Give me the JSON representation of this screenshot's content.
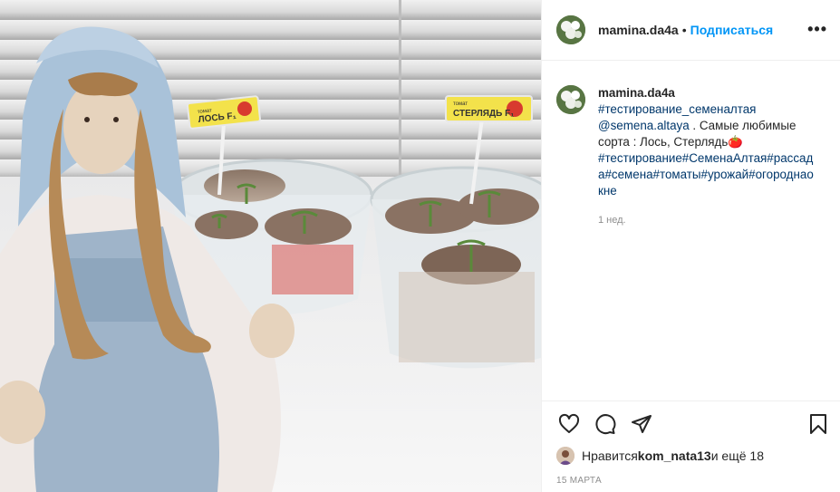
{
  "post": {
    "username": "mamina.da4a",
    "follow_label": "Подписаться",
    "more_label": "•••",
    "dot": "•"
  },
  "caption": {
    "username": "mamina.da4a",
    "tag1": "#тестирование_семеналтая",
    "mention": "@semena.altaya",
    "text1": " . Самые любимые сорта : Лось, Стерлядь",
    "symbol": "🍅",
    "tags2": "#тестирование#СеменаАлтая#рассада#семена#томаты#урожай#огороднаокне",
    "time": "1 нед."
  },
  "photo": {
    "label_left_small": "томат",
    "label_left": "ЛОСЬ F₁",
    "label_right_small": "томат",
    "label_right": "СТЕРЛЯДЬ F₁"
  },
  "likes": {
    "prefix": "Нравится ",
    "user": "kom_nata13",
    "suffix": " и ещё 18"
  },
  "date": "15 МАРТА",
  "colors": {
    "accent": "#0095f6",
    "link": "#00376b",
    "muted": "#8e8e8e",
    "text": "#262626",
    "border": "#efefef"
  },
  "icons": [
    "heart-icon",
    "comment-icon",
    "share-icon",
    "bookmark-icon",
    "more-icon"
  ]
}
